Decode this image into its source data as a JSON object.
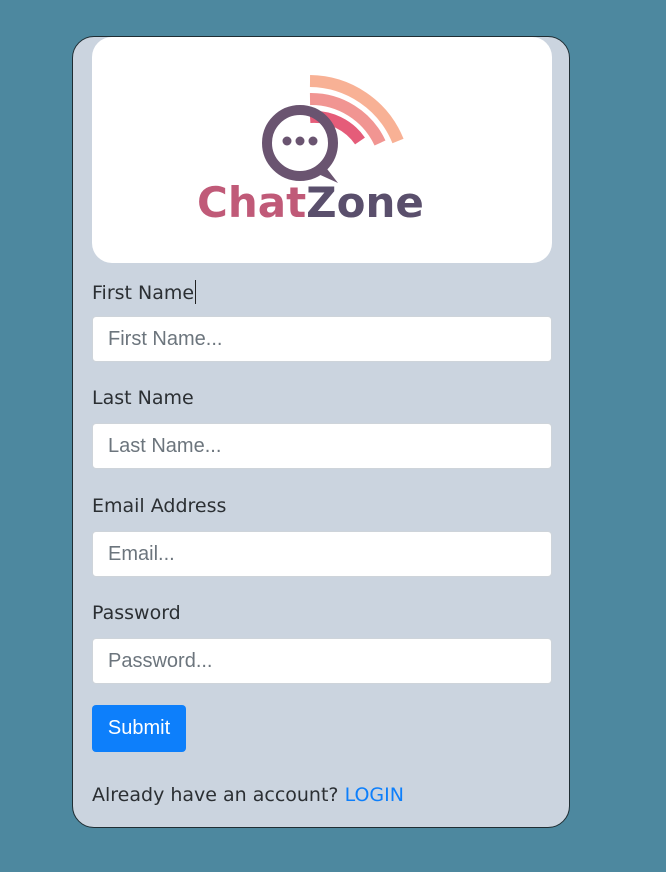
{
  "brand": {
    "logo_text_part1": "Chat",
    "logo_text_part2": "Zone",
    "colors": {
      "chat": "#c05a78",
      "zone": "#5a4f6c",
      "bubble": "#6a5470",
      "wave_inner": "#e24a6a",
      "wave_outer": "#f7a98a"
    }
  },
  "form": {
    "first_name": {
      "label": "First Name",
      "placeholder": "First Name..."
    },
    "last_name": {
      "label": "Last Name",
      "placeholder": "Last Name..."
    },
    "email": {
      "label": "Email Address",
      "placeholder": "Email..."
    },
    "password": {
      "label": "Password",
      "placeholder": "Password..."
    },
    "submit_label": "Submit"
  },
  "footer": {
    "prompt": "Already have an account? ",
    "login_label": "LOGIN"
  },
  "theme": {
    "page_background": "#4d889f",
    "card_background": "#cbd4df",
    "primary": "#0d7ffb"
  }
}
